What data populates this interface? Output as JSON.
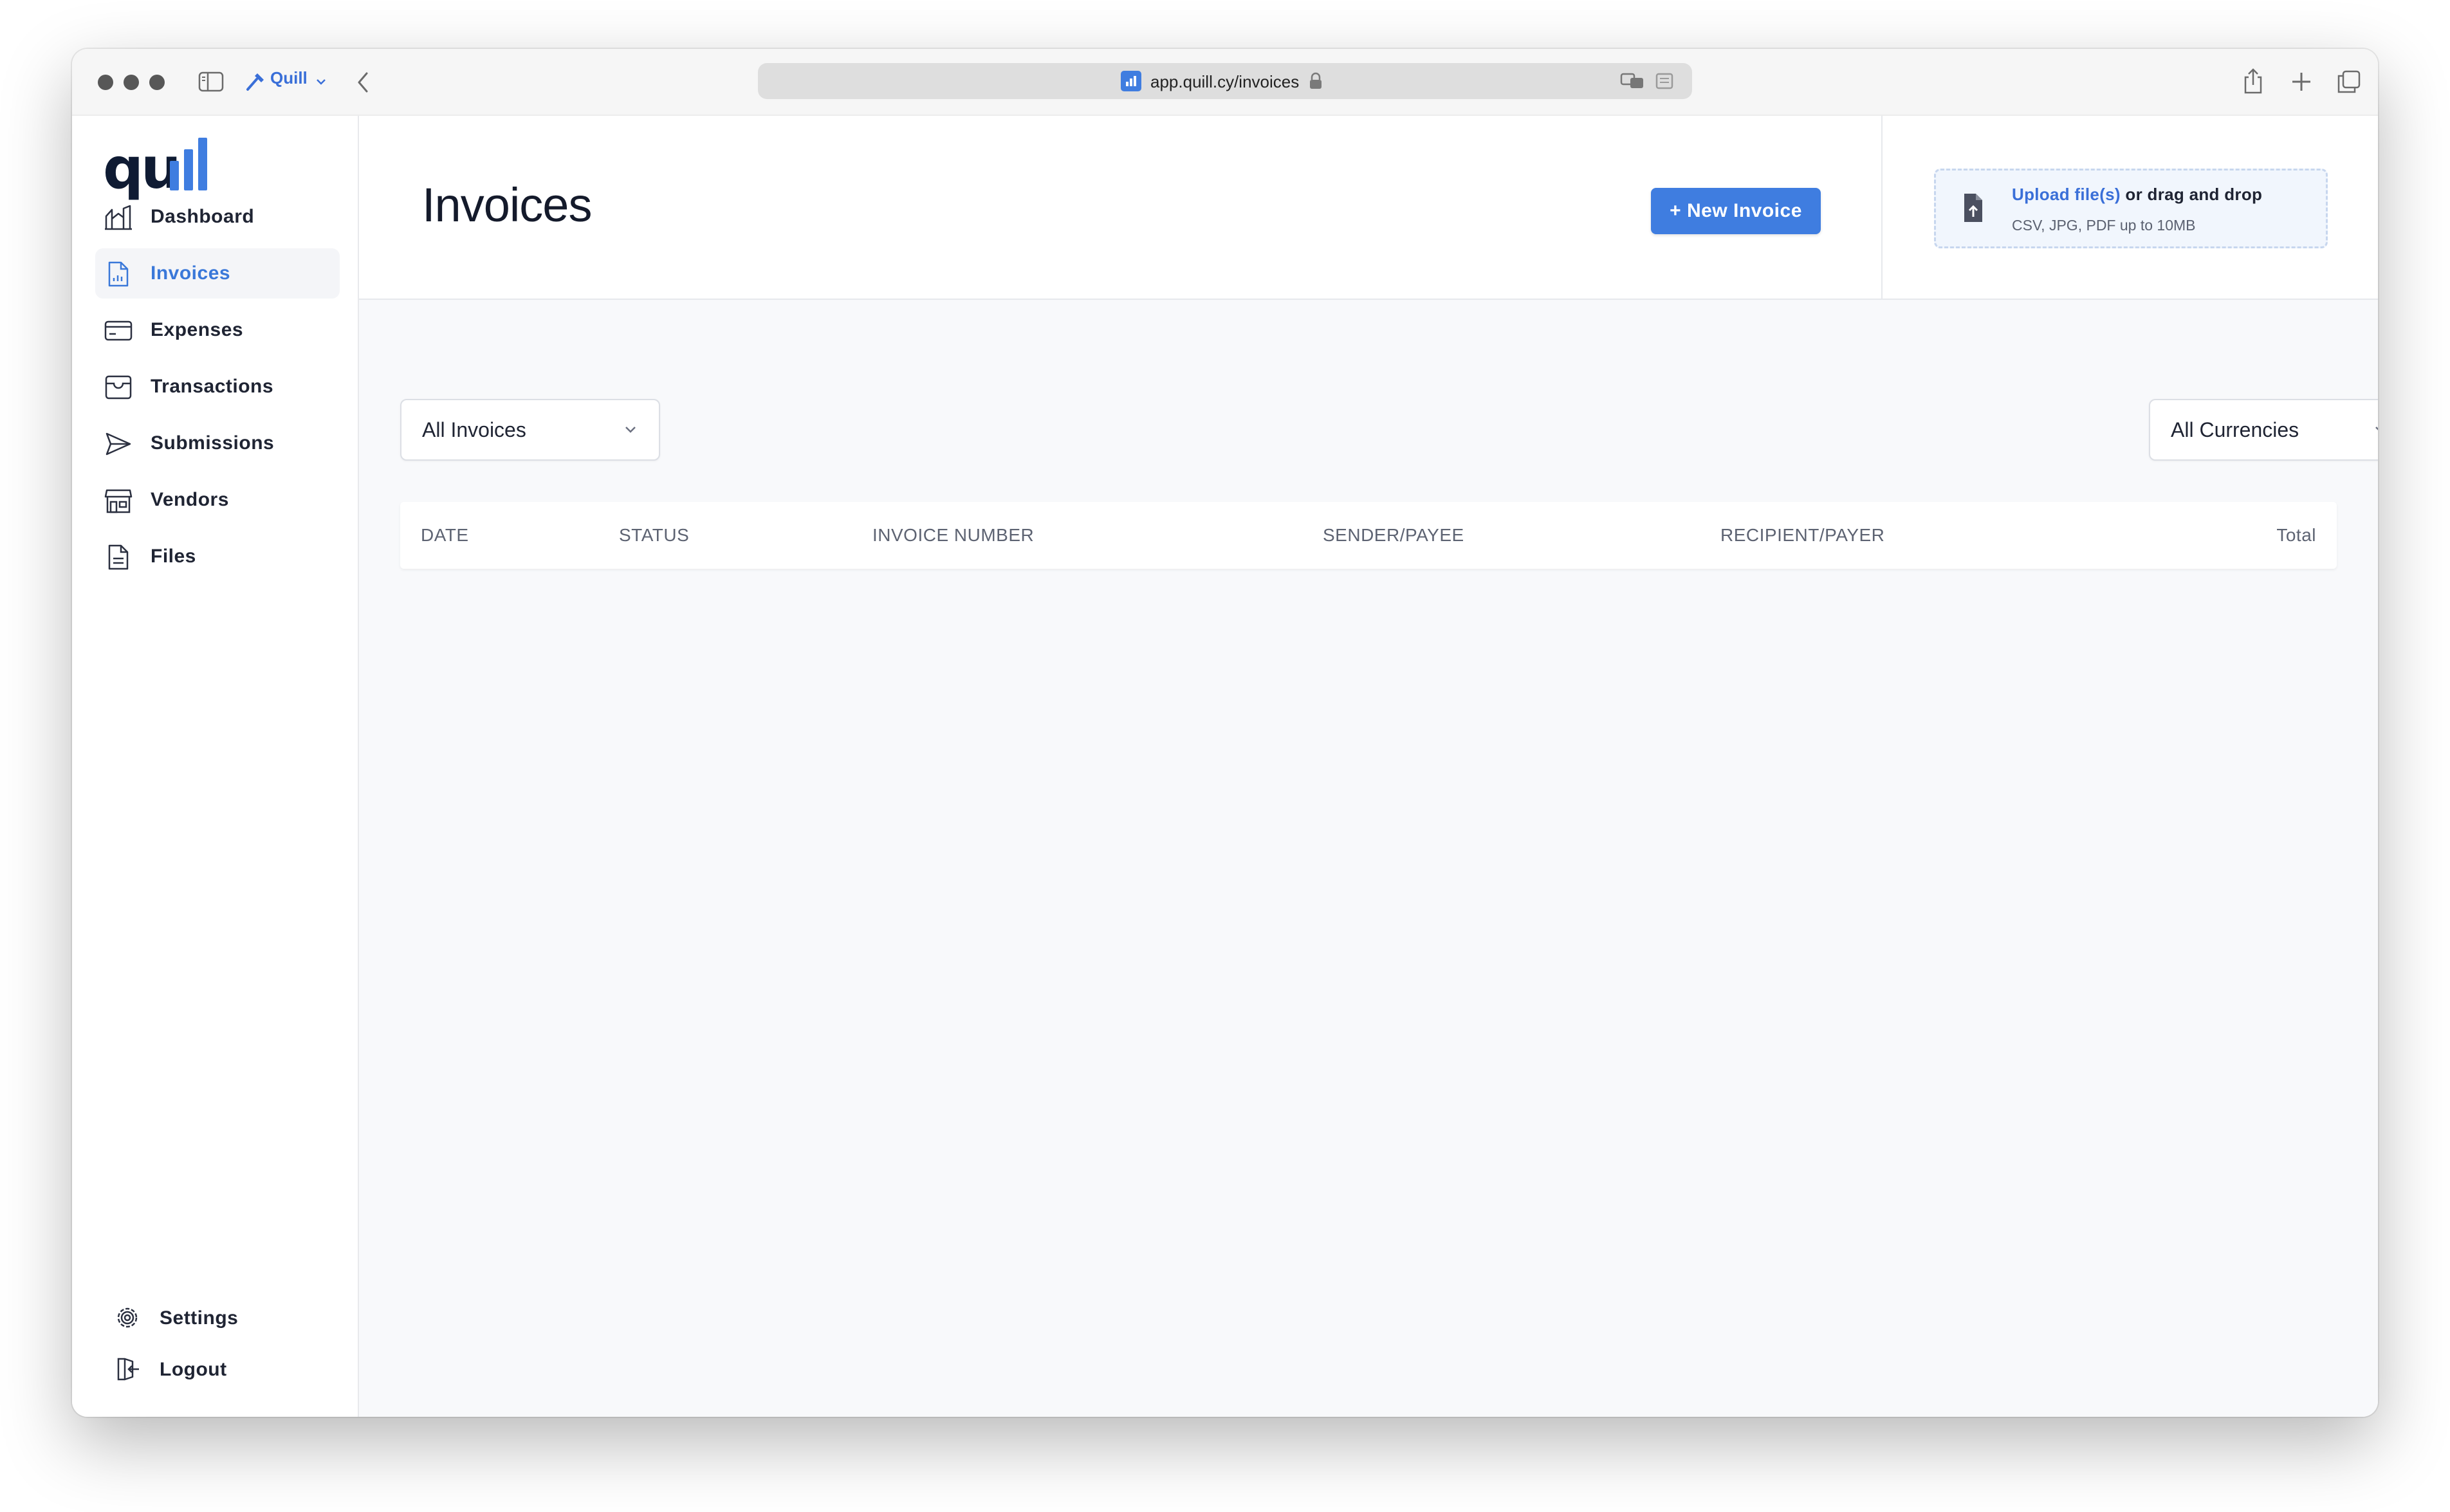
{
  "browser": {
    "profile_label": "Quill",
    "url_host": "app.quill.cy",
    "url_path": "/invoices"
  },
  "app": {
    "logo_text": "qu"
  },
  "sidebar": {
    "items": [
      {
        "label": "Dashboard",
        "icon": "dashboard-chart-icon"
      },
      {
        "label": "Invoices",
        "icon": "invoice-document-icon",
        "active": true
      },
      {
        "label": "Expenses",
        "icon": "credit-card-icon"
      },
      {
        "label": "Transactions",
        "icon": "inbox-tray-icon"
      },
      {
        "label": "Submissions",
        "icon": "paper-plane-icon"
      },
      {
        "label": "Vendors",
        "icon": "storefront-icon"
      },
      {
        "label": "Files",
        "icon": "file-text-icon"
      }
    ],
    "bottom": [
      {
        "label": "Settings",
        "icon": "gear-icon"
      },
      {
        "label": "Logout",
        "icon": "logout-icon"
      }
    ]
  },
  "header": {
    "title": "Invoices",
    "new_button_label": "+ New Invoice"
  },
  "upload": {
    "link_text": "Upload file(s)",
    "rest_text": " or drag and drop",
    "hint": "CSV, JPG, PDF up to 10MB"
  },
  "filters": {
    "invoice_filter_value": "All Invoices",
    "currency_filter_value": "All Currencies"
  },
  "table": {
    "columns": [
      "DATE",
      "STATUS",
      "INVOICE NUMBER",
      "SENDER/PAYEE",
      "RECIPIENT/PAYER",
      "Total"
    ]
  },
  "colors": {
    "accent": "#3f7de0",
    "active_nav_text": "#3a78d9",
    "title_text": "#141a2b",
    "main_bg": "#f8f9fb"
  }
}
